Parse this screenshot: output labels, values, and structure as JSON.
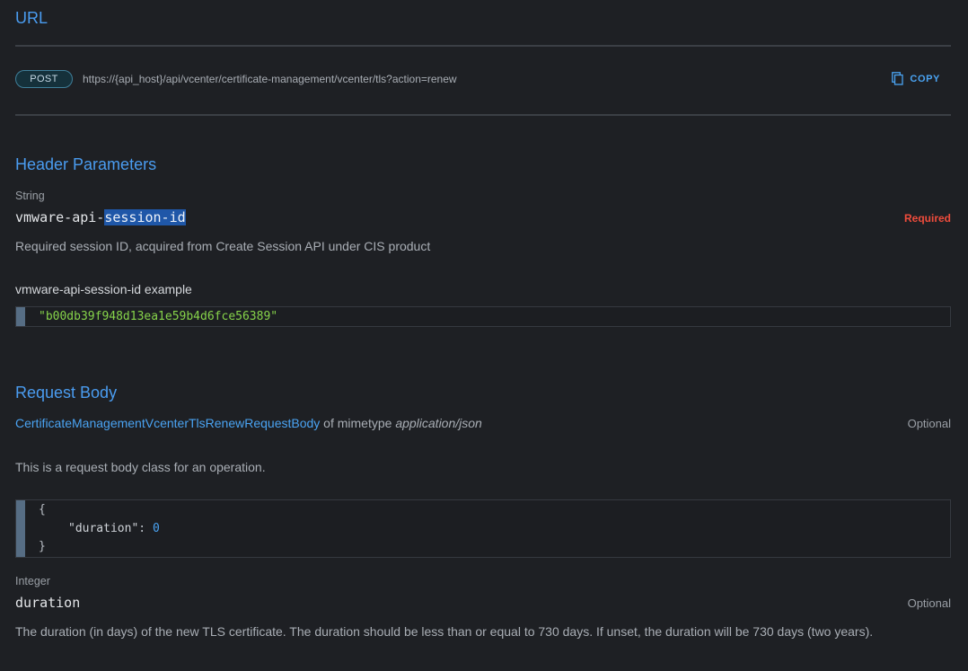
{
  "url_section": {
    "title": "URL",
    "method": "POST",
    "url": "https://{api_host}/api/vcenter/certificate-management/vcenter/tls?action=renew",
    "copy_label": "COPY"
  },
  "header_section": {
    "title": "Header Parameters",
    "param": {
      "type": "String",
      "name_prefix": "vmware-api-",
      "name_highlight": "session-id",
      "required_label": "Required",
      "description": "Required session ID, acquired from Create Session API under CIS product",
      "example_label": "vmware-api-session-id example",
      "example_value": "\"b00db39f948d13ea1e59b4d6fce56389\""
    }
  },
  "body_section": {
    "title": "Request Body",
    "class_link": "CertificateManagementVcenterTlsRenewRequestBody",
    "mimetype_prefix": " of mimetype ",
    "mimetype": "application/json",
    "optional_label": "Optional",
    "description": "This is a request body class for an operation.",
    "code": {
      "open": "{",
      "key": "\"duration\"",
      "sep": ": ",
      "value": "0",
      "close": "}"
    },
    "field": {
      "type": "Integer",
      "name": "duration",
      "optional_label": "Optional",
      "description": "The duration (in days) of the new TLS certificate. The duration should be less than or equal to 730 days. If unset, the duration will be 730 days (two years)."
    }
  },
  "colors": {
    "background": "#1e2024",
    "accent": "#4a9cf0",
    "required": "#ef4c3c",
    "string": "#86d34a"
  }
}
